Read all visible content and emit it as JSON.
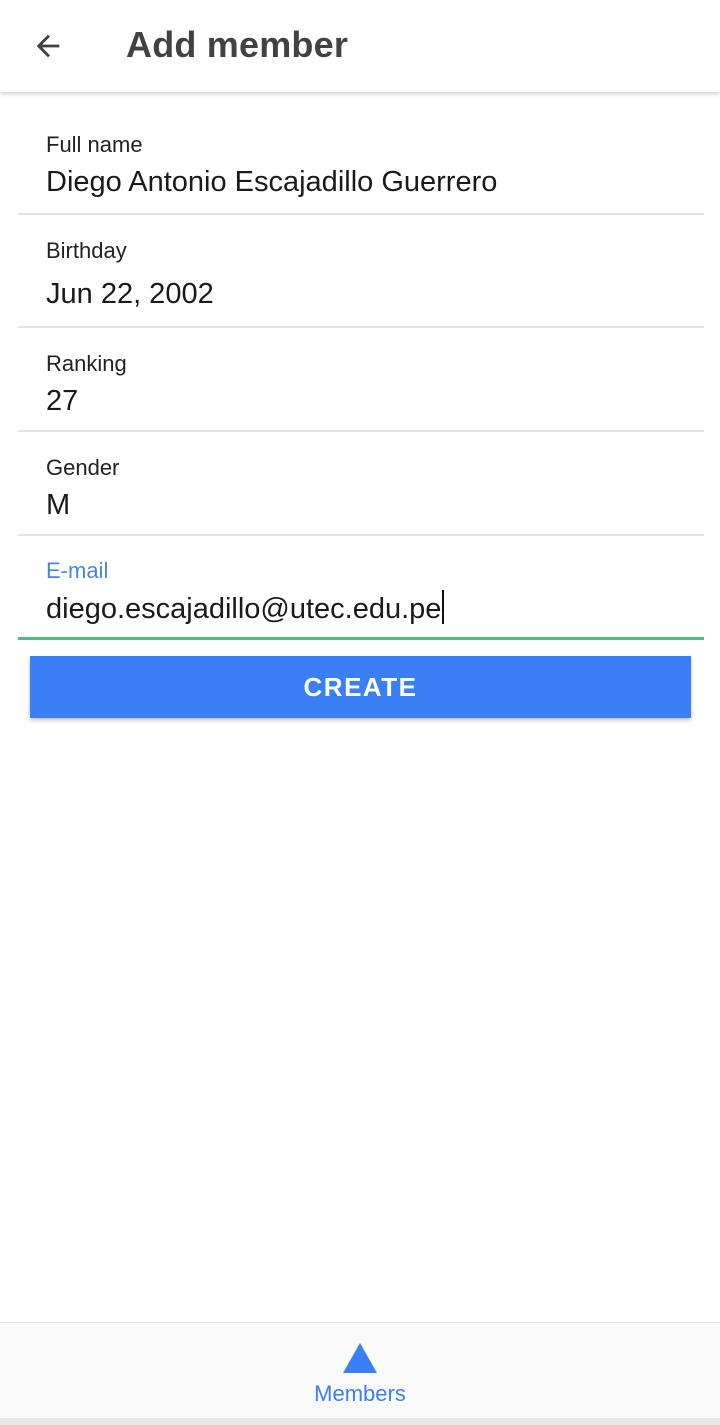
{
  "header": {
    "back_icon": "arrow-left-icon",
    "title": "Add member"
  },
  "form": {
    "fields": [
      {
        "label": "Full name",
        "value": "Diego Antonio Escajadillo Guerrero"
      },
      {
        "label": "Birthday",
        "value": "Jun 22, 2002"
      },
      {
        "label": "Ranking",
        "value": "27"
      },
      {
        "label": "Gender",
        "value": "M"
      },
      {
        "label": "E-mail",
        "value": "diego.escajadillo@utec.edu.pe"
      }
    ],
    "submit_label": "CREATE"
  },
  "bottom_nav": {
    "items": [
      {
        "icon": "triangle-icon",
        "label": "Members",
        "selected": true
      }
    ]
  },
  "colors": {
    "accent": "#3a7ff6",
    "active_underline": "#4bc07f",
    "active_label": "#4a86d8"
  }
}
